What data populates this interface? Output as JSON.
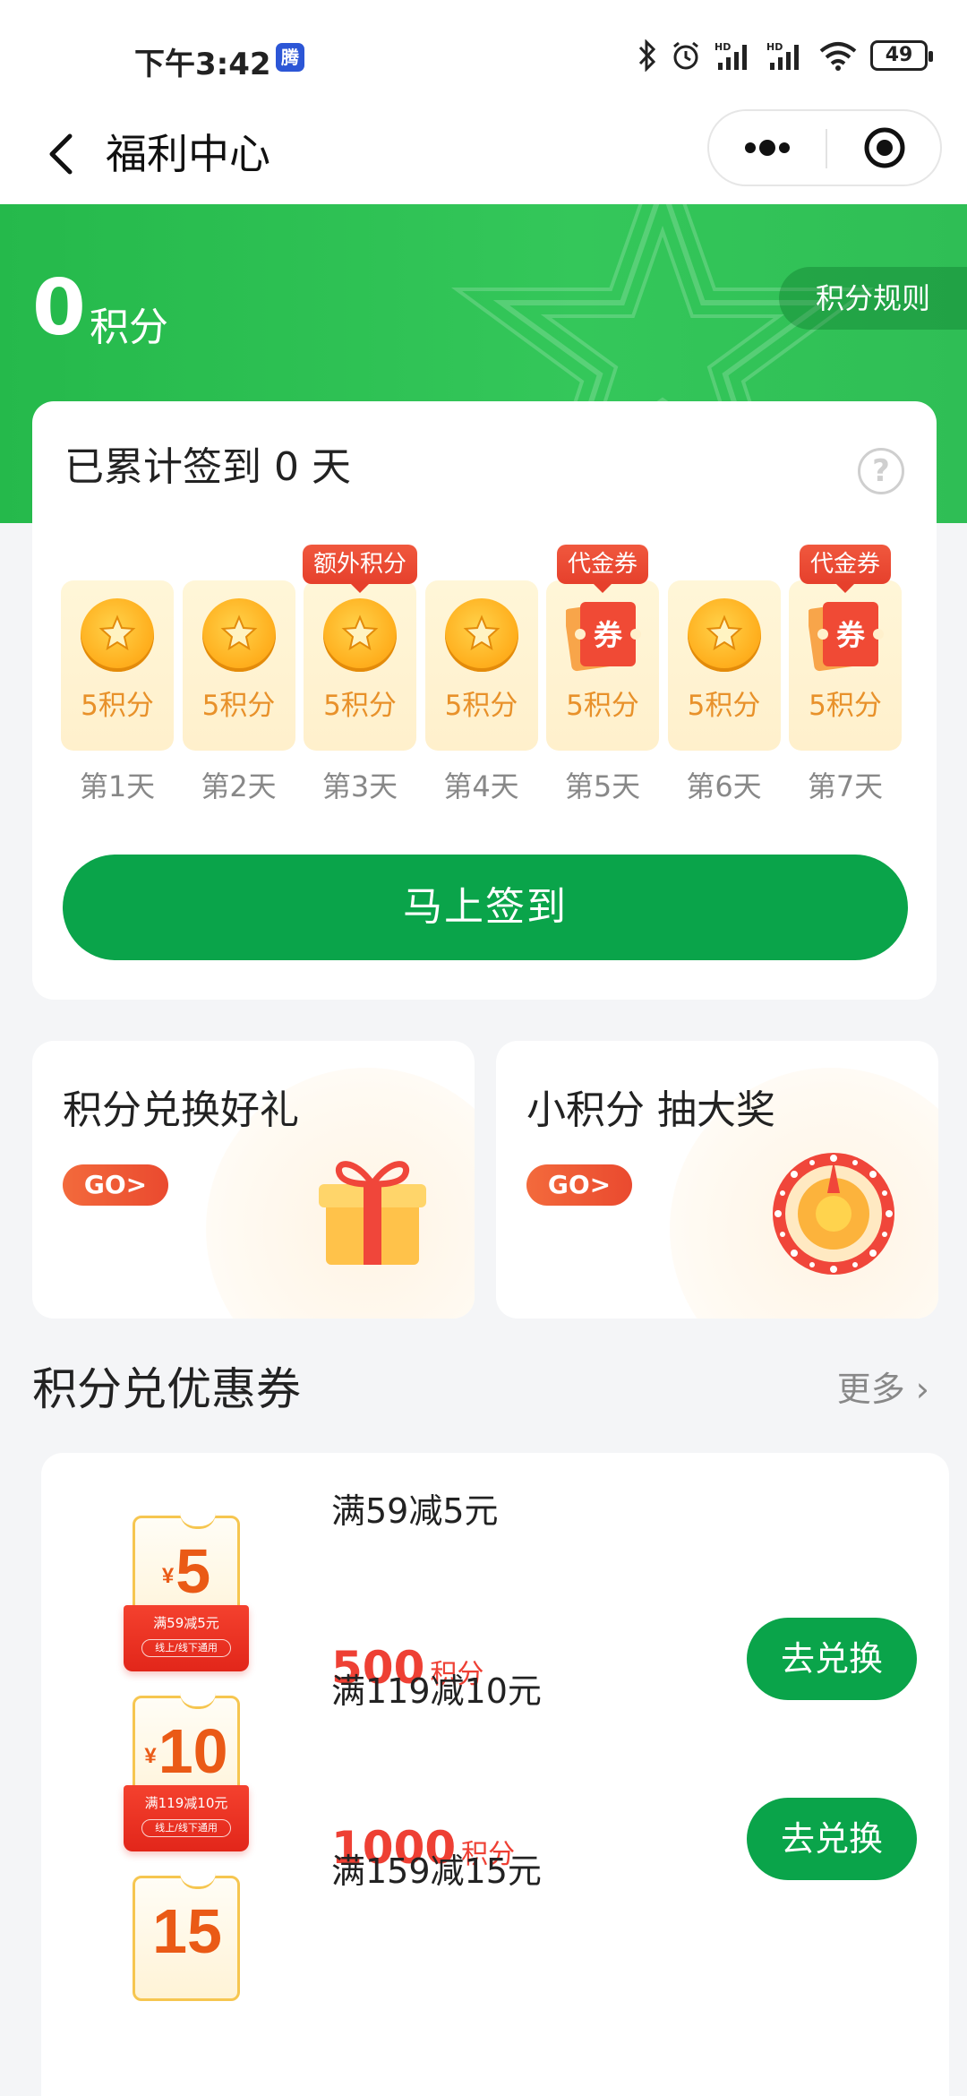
{
  "status_bar": {
    "time": "下午3:42",
    "app_badge": "腾",
    "battery": "49"
  },
  "nav": {
    "title": "福利中心"
  },
  "header": {
    "points": "0",
    "points_unit": "积分",
    "rules_label": "积分规则"
  },
  "checkin": {
    "title": "已累计签到 0 天",
    "help": "?",
    "days": [
      {
        "label": "第1天",
        "points": "5积分",
        "tag": "",
        "reward": "coin-icon"
      },
      {
        "label": "第2天",
        "points": "5积分",
        "tag": "",
        "reward": "coin-icon"
      },
      {
        "label": "第3天",
        "points": "5积分",
        "tag": "额外积分",
        "reward": "coin-icon"
      },
      {
        "label": "第4天",
        "points": "5积分",
        "tag": "",
        "reward": "coin-icon"
      },
      {
        "label": "第5天",
        "points": "5积分",
        "tag": "代金券",
        "reward": "coupon-icon"
      },
      {
        "label": "第6天",
        "points": "5积分",
        "tag": "",
        "reward": "coin-icon"
      },
      {
        "label": "第7天",
        "points": "5积分",
        "tag": "代金券",
        "reward": "coupon-icon"
      }
    ],
    "coupon_glyph": "券",
    "button_label": "马上签到"
  },
  "promos": {
    "left": {
      "title": "积分兑换好礼",
      "go_label": "GO>"
    },
    "right": {
      "title": "小积分 抽大奖",
      "go_label": "GO>"
    }
  },
  "coupon_section": {
    "title": "积分兑优惠券",
    "more_label": "更多"
  },
  "coupons": [
    {
      "title": "满59减5元",
      "points": "500",
      "unit": "积分",
      "button": "去兑换",
      "ticket_amount": "5",
      "ticket_desc": "满59减5元",
      "ticket_tag": "线上/线下通用",
      "yen": "¥"
    },
    {
      "title": "满119减10元",
      "points": "1000",
      "unit": "积分",
      "button": "去兑换",
      "ticket_amount": "10",
      "ticket_desc": "满119减10元",
      "ticket_tag": "线上/线下通用",
      "yen": "¥"
    },
    {
      "title": "满159减15元",
      "points": "",
      "unit": "",
      "button": "",
      "ticket_amount": "15",
      "ticket_desc": "",
      "ticket_tag": "",
      "yen": ""
    }
  ],
  "colors": {
    "brand_green": "#0aa44a",
    "header_green": "#2fbe55",
    "price_red": "#ee4034",
    "coin_orange": "#e8912a"
  }
}
